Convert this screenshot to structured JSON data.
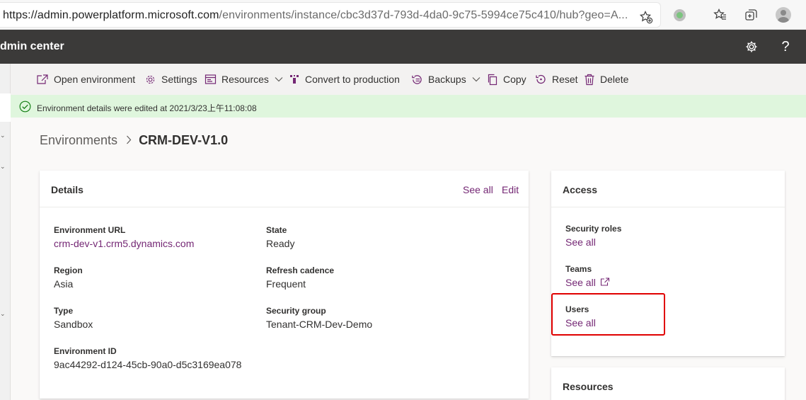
{
  "browser": {
    "url_host": "https://admin.powerplatform.microsoft.com",
    "url_rest": "/environments/instance/cbc3d37d-793d-4da0-9c75-5994ce75c410/hub?geo=A..."
  },
  "header": {
    "title": "dmin center"
  },
  "commands": {
    "open_environment": "Open environment",
    "settings": "Settings",
    "resources": "Resources",
    "convert_to_production": "Convert to production",
    "backups": "Backups",
    "copy": "Copy",
    "reset": "Reset",
    "delete": "Delete"
  },
  "notification": {
    "text": "Environment details were edited at 2021/3/23上午11:08:08"
  },
  "breadcrumb": {
    "parent": "Environments",
    "current": "CRM-DEV-V1.0"
  },
  "details": {
    "title": "Details",
    "see_all": "See all",
    "edit": "Edit",
    "environment_url_label": "Environment URL",
    "environment_url_value": "crm-dev-v1.crm5.dynamics.com",
    "state_label": "State",
    "state_value": "Ready",
    "region_label": "Region",
    "region_value": "Asia",
    "refresh_label": "Refresh cadence",
    "refresh_value": "Frequent",
    "type_label": "Type",
    "type_value": "Sandbox",
    "security_group_label": "Security group",
    "security_group_value": "Tenant-CRM-Dev-Demo",
    "environment_id_label": "Environment ID",
    "environment_id_value": "9ac44292-d124-45cb-90a0-d5c3169ea078"
  },
  "access": {
    "title": "Access",
    "security_roles_label": "Security roles",
    "security_roles_link": "See all",
    "teams_label": "Teams",
    "teams_link": "See all",
    "users_label": "Users",
    "users_link": "See all"
  },
  "resources_card": {
    "title": "Resources"
  },
  "colors": {
    "accent": "#742774",
    "header_bg": "#3b3a39",
    "success_bg": "#dff6dd",
    "highlight": "#e00000"
  }
}
